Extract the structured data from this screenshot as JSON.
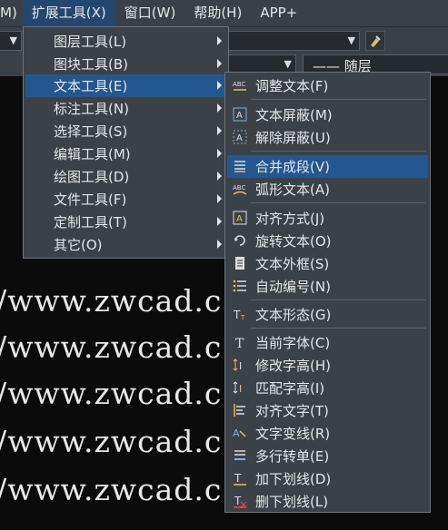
{
  "menubar": {
    "items": [
      "M)",
      "扩展工具(X)",
      "窗口(W)",
      "帮助(H)",
      "APP+"
    ]
  },
  "toolbar": {
    "layer_combo_text": "—— 随层"
  },
  "drawing": {
    "url_text": "'/www.zwcad.c"
  },
  "menu_main": {
    "items": [
      {
        "label": "图层工具(L)"
      },
      {
        "label": "图块工具(B)"
      },
      {
        "label": "文本工具(E)"
      },
      {
        "label": "标注工具(N)"
      },
      {
        "label": "选择工具(S)"
      },
      {
        "label": "编辑工具(M)"
      },
      {
        "label": "绘图工具(D)"
      },
      {
        "label": "文件工具(F)"
      },
      {
        "label": "定制工具(T)"
      },
      {
        "label": "其它(O)"
      }
    ]
  },
  "menu_text_tools": {
    "items": [
      {
        "label": "调整文本(F)",
        "icon": "abc-adjust-icon"
      },
      {
        "label": "文本屏蔽(M)",
        "icon": "text-mask-icon"
      },
      {
        "label": "解除屏蔽(U)",
        "icon": "text-unmask-icon"
      },
      {
        "label": "合并成段(V)",
        "icon": "merge-paragraph-icon"
      },
      {
        "label": "弧形文本(A)",
        "icon": "arc-text-icon"
      },
      {
        "label": "对齐方式(J)",
        "icon": "justify-icon"
      },
      {
        "label": "旋转文本(O)",
        "icon": "rotate-text-icon"
      },
      {
        "label": "文本外框(S)",
        "icon": "text-frame-icon"
      },
      {
        "label": "自动编号(N)",
        "icon": "auto-number-icon"
      },
      {
        "label": "文本形态(G)",
        "icon": "text-shape-icon"
      },
      {
        "label": "当前字体(C)",
        "icon": "current-font-icon"
      },
      {
        "label": "修改字高(H)",
        "icon": "modify-height-icon"
      },
      {
        "label": "匹配字高(I)",
        "icon": "match-height-icon"
      },
      {
        "label": "对齐文字(T)",
        "icon": "align-text-icon"
      },
      {
        "label": "文字变线(R)",
        "icon": "text-to-line-icon"
      },
      {
        "label": "多行转单(E)",
        "icon": "multiline-to-single-icon"
      },
      {
        "label": "加下划线(D)",
        "icon": "add-underline-icon"
      },
      {
        "label": "删下划线(L)",
        "icon": "remove-underline-icon"
      }
    ]
  },
  "colors": {
    "menu_bg": "#3c4148",
    "highlight": "#23578f",
    "menubar_active": "#23476f"
  }
}
